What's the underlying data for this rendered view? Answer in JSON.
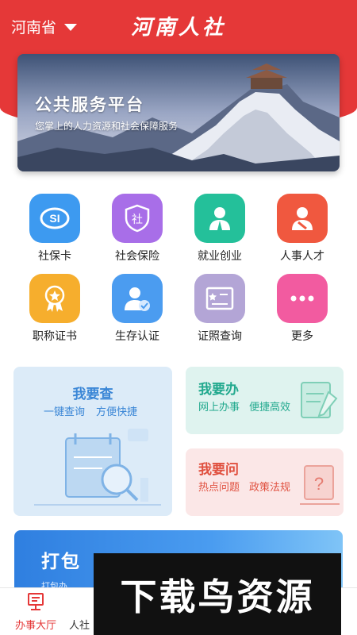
{
  "header": {
    "province": "河南省",
    "title": "河南人社",
    "accent": "#e53838"
  },
  "banner": {
    "title": "公共服务平台",
    "subtitle": "您掌上的人力资源和社会保障服务"
  },
  "services": [
    {
      "label": "社保卡",
      "icon": "social-security-card-icon",
      "color": "#3d9af0"
    },
    {
      "label": "社会保险",
      "icon": "social-insurance-shield-icon",
      "color": "#a86ee8"
    },
    {
      "label": "就业创业",
      "icon": "employment-person-icon",
      "color": "#24c09a"
    },
    {
      "label": "人事人才",
      "icon": "talent-person-icon",
      "color": "#f0583f"
    },
    {
      "label": "职称证书",
      "icon": "award-medal-icon",
      "color": "#f6ae2d"
    },
    {
      "label": "生存认证",
      "icon": "user-verify-icon",
      "color": "#4b9cf0"
    },
    {
      "label": "证照查询",
      "icon": "certificate-icon",
      "color": "#b3a5d6"
    },
    {
      "label": "更多",
      "icon": "more-dots-icon",
      "color": "#f25ba0"
    }
  ],
  "cards": {
    "check": {
      "title": "我要查",
      "subtitle_1": "一键查询",
      "subtitle_2": "方便快捷",
      "color": "#3a86d6"
    },
    "do": {
      "title": "我要办",
      "subtitle_1": "网上办事",
      "subtitle_2": "便捷高效",
      "color": "#22a98e"
    },
    "ask": {
      "title": "我要问",
      "subtitle_1": "热点问题",
      "subtitle_2": "政策法规",
      "color": "#e0503f"
    }
  },
  "promo": {
    "title": "打包",
    "subtitle": "打包办"
  },
  "tabs": [
    {
      "label": "办事大厅",
      "icon": "service-hall-icon",
      "active": true
    },
    {
      "label": "人社",
      "icon": "news-icon",
      "active": false
    }
  ],
  "watermark": {
    "text": "下载鸟资源"
  }
}
